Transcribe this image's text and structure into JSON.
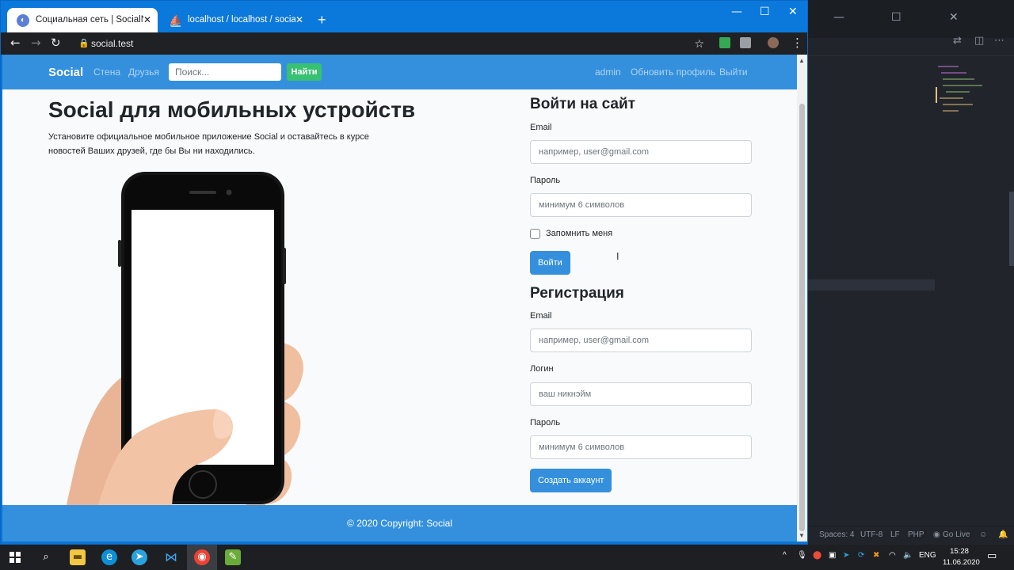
{
  "browser": {
    "tabs": [
      {
        "title": "Социальная сеть | SocialNetwork",
        "active": true
      },
      {
        "title": "localhost / localhost / social / fri",
        "active": false
      }
    ],
    "url": "social.test"
  },
  "site": {
    "brand": "Social",
    "nav_left": [
      "Стена",
      "Друзья"
    ],
    "search_placeholder": "Поиск...",
    "search_button": "Найти",
    "nav_right": [
      "admin",
      "Обновить профиль",
      "Выйти"
    ]
  },
  "hero": {
    "title": "Social для мобильных устройств",
    "text": "Установите официальное мобильное приложение Social и оставайтесь в курсе новостей Ваших друзей, где бы Вы ни находились."
  },
  "login": {
    "title": "Войти на сайт",
    "email_label": "Email",
    "email_placeholder": "например, user@gmail.com",
    "password_label": "Пароль",
    "password_placeholder": "минимум 6 символов",
    "remember_label": "Запомнить меня",
    "submit": "Войти"
  },
  "register": {
    "title": "Регистрация",
    "email_label": "Email",
    "email_placeholder": "например, user@gmail.com",
    "login_label": "Логин",
    "login_placeholder": "ваш никнэйм",
    "password_label": "Пароль",
    "password_placeholder": "минимум 6 символов",
    "submit": "Создать аккаунт"
  },
  "footer": {
    "text": "© 2020 Copyright: Social"
  },
  "editor_status": {
    "spaces": "Spaces: 4",
    "encoding": "UTF-8",
    "eol": "LF",
    "lang": "PHP",
    "golive": "Go Live"
  },
  "taskbar": {
    "lang": "ENG",
    "time": "15:28",
    "date": "11.06.2020"
  },
  "colors": {
    "primary": "#3490dc",
    "success": "#38c172",
    "chrome_blue": "#0b78dc"
  }
}
